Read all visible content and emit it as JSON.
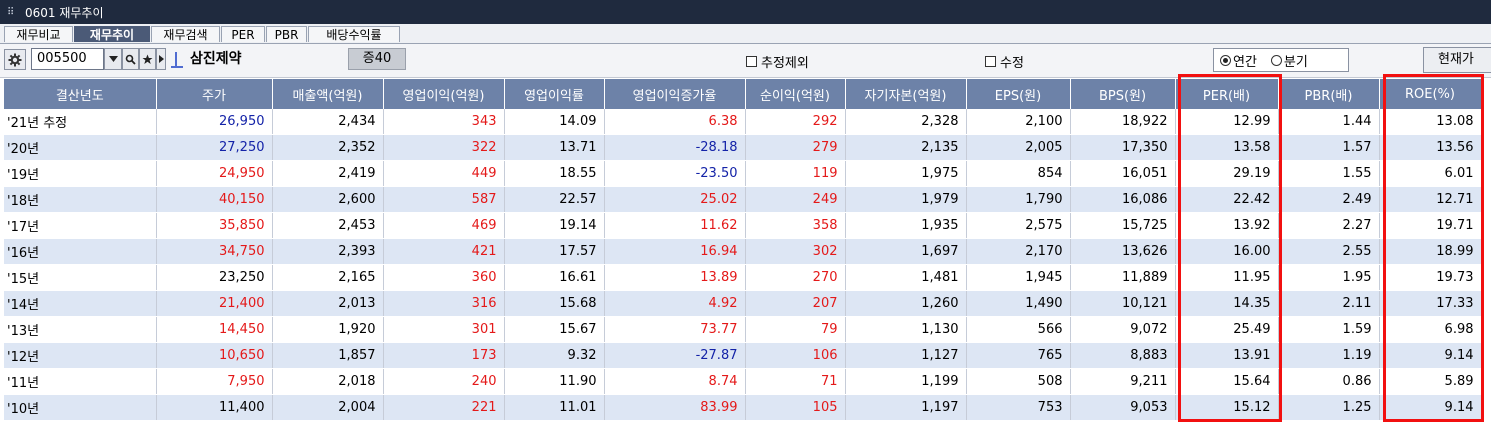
{
  "window": {
    "title": "0601 재무추이"
  },
  "tabs": [
    {
      "label": "재무비교",
      "active": false
    },
    {
      "label": "재무추이",
      "active": true
    },
    {
      "label": "재무검색",
      "active": false
    },
    {
      "label": "PER",
      "active": false
    },
    {
      "label": "PBR",
      "active": false
    },
    {
      "label": "배당수익률",
      "active": false
    }
  ],
  "toolbar": {
    "stock_code": "005500",
    "stock_name": "삼진제약",
    "market_badge": "증40",
    "checkbox_estimate_exclude": "추정제외",
    "checkbox_revise": "수정",
    "radio_annual": "연간",
    "radio_quarter": "분기",
    "radio_annual_selected": true,
    "current_button": "현재가"
  },
  "table": {
    "columns": [
      "결산년도",
      "주가",
      "매출액(억원)",
      "영업이익(억원)",
      "영업이익률",
      "영업이익증가율",
      "순이익(억원)",
      "자기자본(억원)",
      "EPS(원)",
      "BPS(원)",
      "PER(배)",
      "PBR(배)",
      "ROE(%)"
    ],
    "rows": [
      {
        "year": "'21년 추정",
        "price": "26,950",
        "sales": "2,434",
        "op": "343",
        "opm": "14.09",
        "opg": "6.38",
        "net": "292",
        "equity": "2,328",
        "eps": "2,100",
        "bps": "18,922",
        "per": "12.99",
        "pbr": "1.44",
        "roe": "13.08"
      },
      {
        "year": "'20년",
        "price": "27,250",
        "sales": "2,352",
        "op": "322",
        "opm": "13.71",
        "opg": "-28.18",
        "net": "279",
        "equity": "2,135",
        "eps": "2,005",
        "bps": "17,350",
        "per": "13.58",
        "pbr": "1.57",
        "roe": "13.56"
      },
      {
        "year": "'19년",
        "price": "24,950",
        "sales": "2,419",
        "op": "449",
        "opm": "18.55",
        "opg": "-23.50",
        "net": "119",
        "equity": "1,975",
        "eps": "854",
        "bps": "16,051",
        "per": "29.19",
        "pbr": "1.55",
        "roe": "6.01"
      },
      {
        "year": "'18년",
        "price": "40,150",
        "sales": "2,600",
        "op": "587",
        "opm": "22.57",
        "opg": "25.02",
        "net": "249",
        "equity": "1,979",
        "eps": "1,790",
        "bps": "16,086",
        "per": "22.42",
        "pbr": "2.49",
        "roe": "12.71"
      },
      {
        "year": "'17년",
        "price": "35,850",
        "sales": "2,453",
        "op": "469",
        "opm": "19.14",
        "opg": "11.62",
        "net": "358",
        "equity": "1,935",
        "eps": "2,575",
        "bps": "15,725",
        "per": "13.92",
        "pbr": "2.27",
        "roe": "19.71"
      },
      {
        "year": "'16년",
        "price": "34,750",
        "sales": "2,393",
        "op": "421",
        "opm": "17.57",
        "opg": "16.94",
        "net": "302",
        "equity": "1,697",
        "eps": "2,170",
        "bps": "13,626",
        "per": "16.00",
        "pbr": "2.55",
        "roe": "18.99"
      },
      {
        "year": "'15년",
        "price": "23,250",
        "sales": "2,165",
        "op": "360",
        "opm": "16.61",
        "opg": "13.89",
        "net": "270",
        "equity": "1,481",
        "eps": "1,945",
        "bps": "11,889",
        "per": "11.95",
        "pbr": "1.95",
        "roe": "19.73"
      },
      {
        "year": "'14년",
        "price": "21,400",
        "sales": "2,013",
        "op": "316",
        "opm": "15.68",
        "opg": "4.92",
        "net": "207",
        "equity": "1,260",
        "eps": "1,490",
        "bps": "10,121",
        "per": "14.35",
        "pbr": "2.11",
        "roe": "17.33"
      },
      {
        "year": "'13년",
        "price": "14,450",
        "sales": "1,920",
        "op": "301",
        "opm": "15.67",
        "opg": "73.77",
        "net": "79",
        "equity": "1,130",
        "eps": "566",
        "bps": "9,072",
        "per": "25.49",
        "pbr": "1.59",
        "roe": "6.98"
      },
      {
        "year": "'12년",
        "price": "10,650",
        "sales": "1,857",
        "op": "173",
        "opm": "9.32",
        "opg": "-27.87",
        "net": "106",
        "equity": "1,127",
        "eps": "765",
        "bps": "8,883",
        "per": "13.91",
        "pbr": "1.19",
        "roe": "9.14"
      },
      {
        "year": "'11년",
        "price": "7,950",
        "sales": "2,018",
        "op": "240",
        "opm": "11.90",
        "opg": "8.74",
        "net": "71",
        "equity": "1,199",
        "eps": "508",
        "bps": "9,211",
        "per": "15.64",
        "pbr": "0.86",
        "roe": "5.89"
      },
      {
        "year": "'10년",
        "price": "11,400",
        "sales": "2,004",
        "op": "221",
        "opm": "11.01",
        "opg": "83.99",
        "net": "105",
        "equity": "1,197",
        "eps": "753",
        "bps": "9,053",
        "per": "15.12",
        "pbr": "1.25",
        "roe": "9.14"
      }
    ],
    "price_colors": [
      "blue",
      "blue",
      "red",
      "red",
      "red",
      "red",
      "black",
      "red",
      "red",
      "red",
      "red",
      "black"
    ],
    "op_color": "red",
    "net_color": "red",
    "opg_colors": [
      "red",
      "blue",
      "blue",
      "red",
      "red",
      "red",
      "red",
      "red",
      "red",
      "blue",
      "red",
      "red"
    ],
    "highlighted_columns": [
      "PER(배)",
      "ROE(%)"
    ]
  },
  "colors": {
    "header_bg": "#6d82a8",
    "alt_row": "#dde6f4",
    "red": "#e41919",
    "blue": "#1423a8",
    "highlight": "#f21010"
  }
}
